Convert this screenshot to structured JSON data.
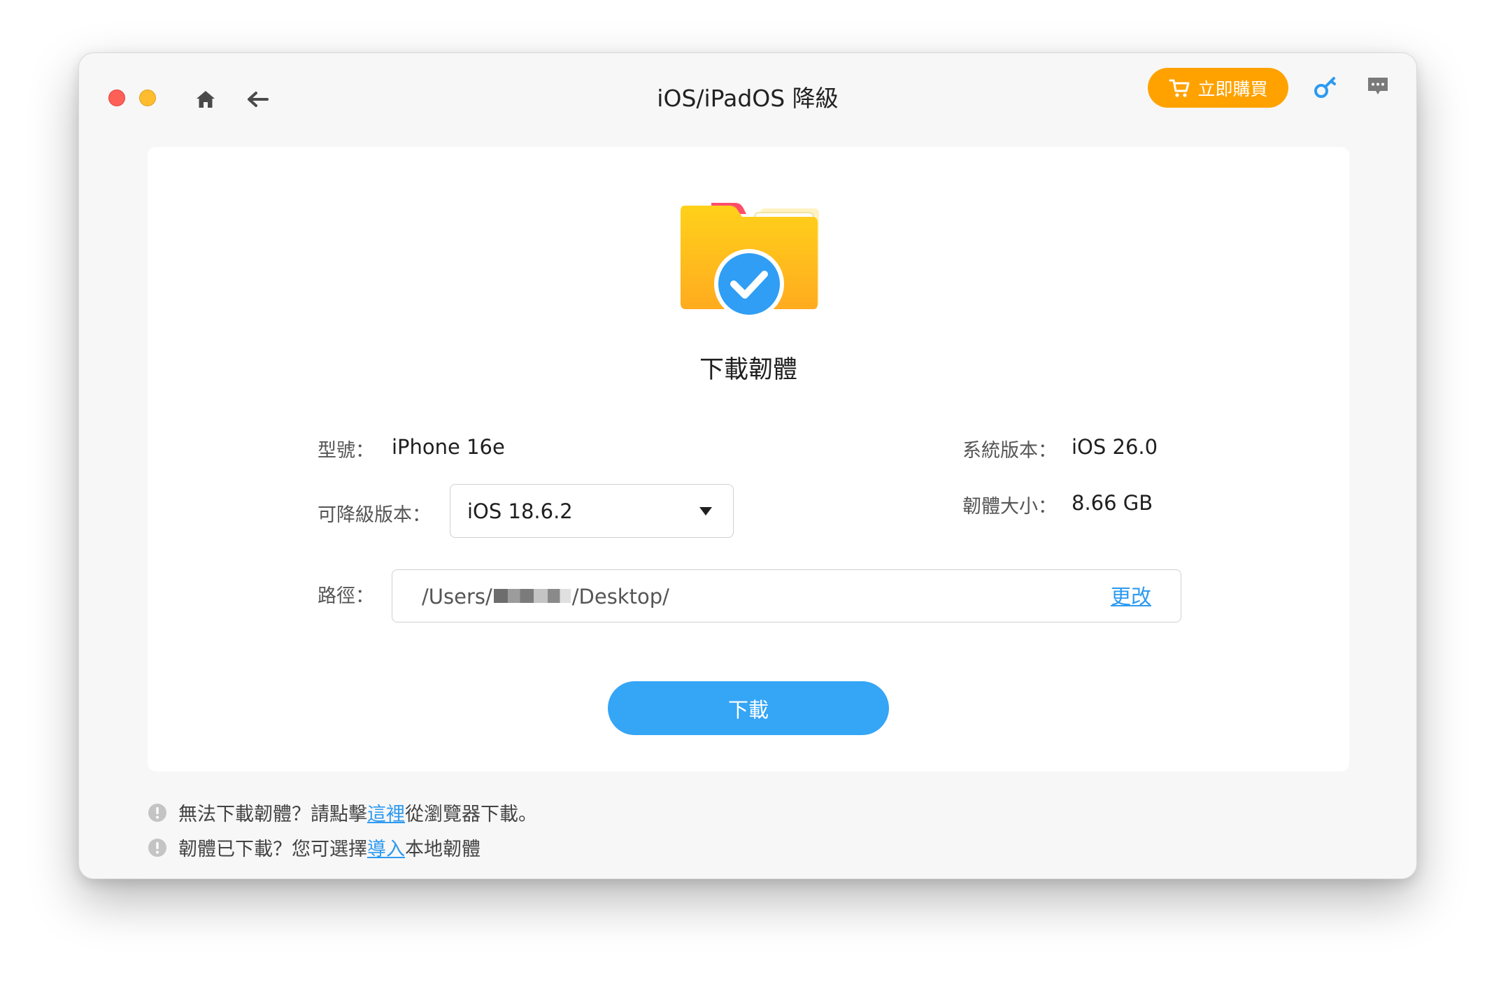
{
  "window": {
    "title": "iOS/iPadOS 降級"
  },
  "toolbar": {
    "buy_label": "立即購買",
    "icons": [
      "home-icon",
      "back-arrow-icon",
      "cart-icon",
      "key-icon",
      "feedback-icon"
    ]
  },
  "card": {
    "title": "下載韌體",
    "model_label": "型號：",
    "model_value": "iPhone 16e",
    "system_label": "系統版本：",
    "system_value": "iOS 26.0",
    "downgrade_label": "可降級版本：",
    "downgrade_value": "iOS 18.6.2",
    "size_label": "韌體大小：",
    "size_value": "8.66 GB",
    "path_label": "路徑：",
    "path_prefix": "/Users/",
    "path_suffix": "/Desktop/",
    "change_label": "更改",
    "download_label": "下載"
  },
  "footer": {
    "note1_before": "無法下載韌體？請點擊",
    "note1_link": "這裡",
    "note1_after": "從瀏覽器下載。",
    "note2_before": "韌體已下載？您可選擇",
    "note2_link": "導入",
    "note2_after": "本地韌體"
  },
  "colors": {
    "accent_blue": "#35a5f6",
    "link_blue": "#2d9af0",
    "buy_orange": "#ffa200",
    "close_red": "#fe5f57",
    "minimize_yellow": "#febc2e"
  }
}
